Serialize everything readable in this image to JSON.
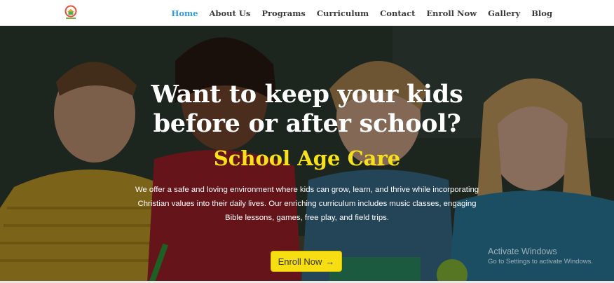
{
  "nav": {
    "items": [
      {
        "label": "Home",
        "active": true
      },
      {
        "label": "About Us"
      },
      {
        "label": "Programs"
      },
      {
        "label": "Curriculum"
      },
      {
        "label": "Contact"
      },
      {
        "label": "Enroll Now"
      },
      {
        "label": "Gallery"
      },
      {
        "label": "Blog"
      }
    ]
  },
  "hero": {
    "headline_line1": "Want to keep your kids",
    "headline_line2": "before or after school?",
    "subheading": "School Age Care",
    "description": "We offer a safe and loving environment where kids can grow, learn, and thrive while incorporating Christian values into their daily lives. Our enriching curriculum includes music classes, engaging Bible lessons, games, free play, and field trips.",
    "cta_label": "Enroll Now",
    "cta_icon": "arrow-right-icon"
  },
  "watermark": {
    "line1": "Activate Windows",
    "line2": "Go to Settings to activate Windows."
  },
  "colors": {
    "accent": "#2e9bd6",
    "headline": "#ffffff",
    "subheading": "#f7e11a",
    "cta_bg": "#f6de12"
  }
}
